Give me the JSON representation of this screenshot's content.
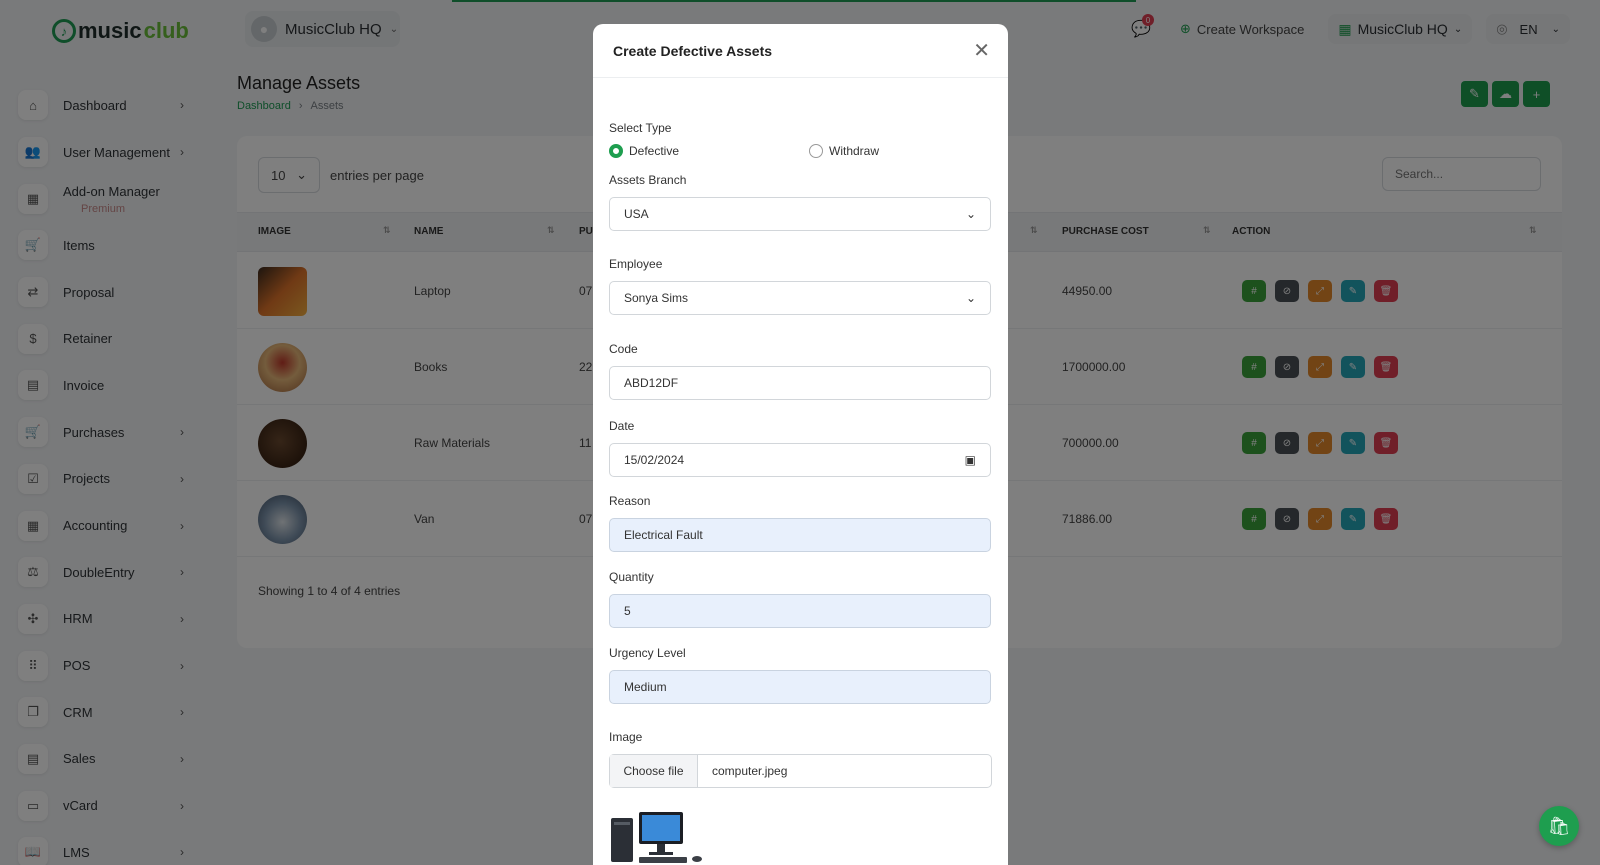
{
  "logo": {
    "icon": "music-note-icon",
    "text_a": "music",
    "text_b": "club"
  },
  "workspace": {
    "name": "MusicClub HQ"
  },
  "header": {
    "chat_badge": "0",
    "create_workspace": "Create Workspace",
    "workspace_menu": "MusicClub HQ",
    "language": "EN"
  },
  "sidebar": {
    "items": [
      {
        "label": "Dashboard",
        "icon": "home-icon",
        "chevron": true
      },
      {
        "label": "User Management",
        "icon": "users-icon",
        "chevron": true
      },
      {
        "label": "Add-on Manager",
        "sub": "Premium",
        "icon": "grid-icon",
        "chevron": false
      },
      {
        "label": "Items",
        "icon": "cart-icon",
        "chevron": false
      },
      {
        "label": "Proposal",
        "icon": "proposal-icon",
        "chevron": false
      },
      {
        "label": "Retainer",
        "icon": "retainer-icon",
        "chevron": false
      },
      {
        "label": "Invoice",
        "icon": "invoice-icon",
        "chevron": false
      },
      {
        "label": "Purchases",
        "icon": "cart-icon",
        "chevron": true
      },
      {
        "label": "Projects",
        "icon": "checkbox-icon",
        "chevron": true
      },
      {
        "label": "Accounting",
        "icon": "grid-icon",
        "chevron": true
      },
      {
        "label": "DoubleEntry",
        "icon": "scale-icon",
        "chevron": true
      },
      {
        "label": "HRM",
        "icon": "hrm-icon",
        "chevron": true
      },
      {
        "label": "POS",
        "icon": "dots-grid-icon",
        "chevron": true
      },
      {
        "label": "CRM",
        "icon": "crm-icon",
        "chevron": true
      },
      {
        "label": "Sales",
        "icon": "sales-icon",
        "chevron": true
      },
      {
        "label": "vCard",
        "icon": "card-icon",
        "chevron": true
      },
      {
        "label": "LMS",
        "icon": "book-icon",
        "chevron": true
      }
    ]
  },
  "page": {
    "title": "Manage Assets",
    "breadcrumb": [
      "Dashboard",
      "Assets"
    ]
  },
  "table": {
    "entries_value": "10",
    "entries_label": "entries per page",
    "search_placeholder": "Search...",
    "columns": {
      "image": "IMAGE",
      "name": "NAME",
      "purchase": "PU",
      "cost": "PURCHASE COST",
      "action": "ACTION"
    },
    "rows": [
      {
        "name": "Laptop",
        "purchase": "07",
        "cost": "44950.00"
      },
      {
        "name": "Books",
        "purchase": "22",
        "cost": "1700000.00"
      },
      {
        "name": "Raw Materials",
        "purchase": "11",
        "cost": "700000.00"
      },
      {
        "name": "Van",
        "purchase": "07",
        "cost": "71886.00"
      }
    ],
    "showing": "Showing 1 to 4 of 4 entries"
  },
  "modal": {
    "title": "Create Defective Assets",
    "select_type_label": "Select Type",
    "type_options": [
      "Defective",
      "Withdraw"
    ],
    "selected_type": "Defective",
    "branch_label": "Assets Branch",
    "branch_value": "USA",
    "employee_label": "Employee",
    "employee_value": "Sonya Sims",
    "code_label": "Code",
    "code_value": "ABD12DF",
    "date_label": "Date",
    "date_value": "15/02/2024",
    "reason_label": "Reason",
    "reason_value": "Electrical Fault",
    "quantity_label": "Quantity",
    "quantity_value": "5",
    "urgency_label": "Urgency Level",
    "urgency_value": "Medium",
    "image_label": "Image",
    "choose_file": "Choose file",
    "file_name": "computer.jpeg"
  },
  "colors": {
    "primary": "#1e9e4f",
    "danger": "#e03e52",
    "info": "#25a6b8",
    "warning": "#e5892a",
    "dark": "#4a5056",
    "filled_bg": "#e8f0fc"
  }
}
